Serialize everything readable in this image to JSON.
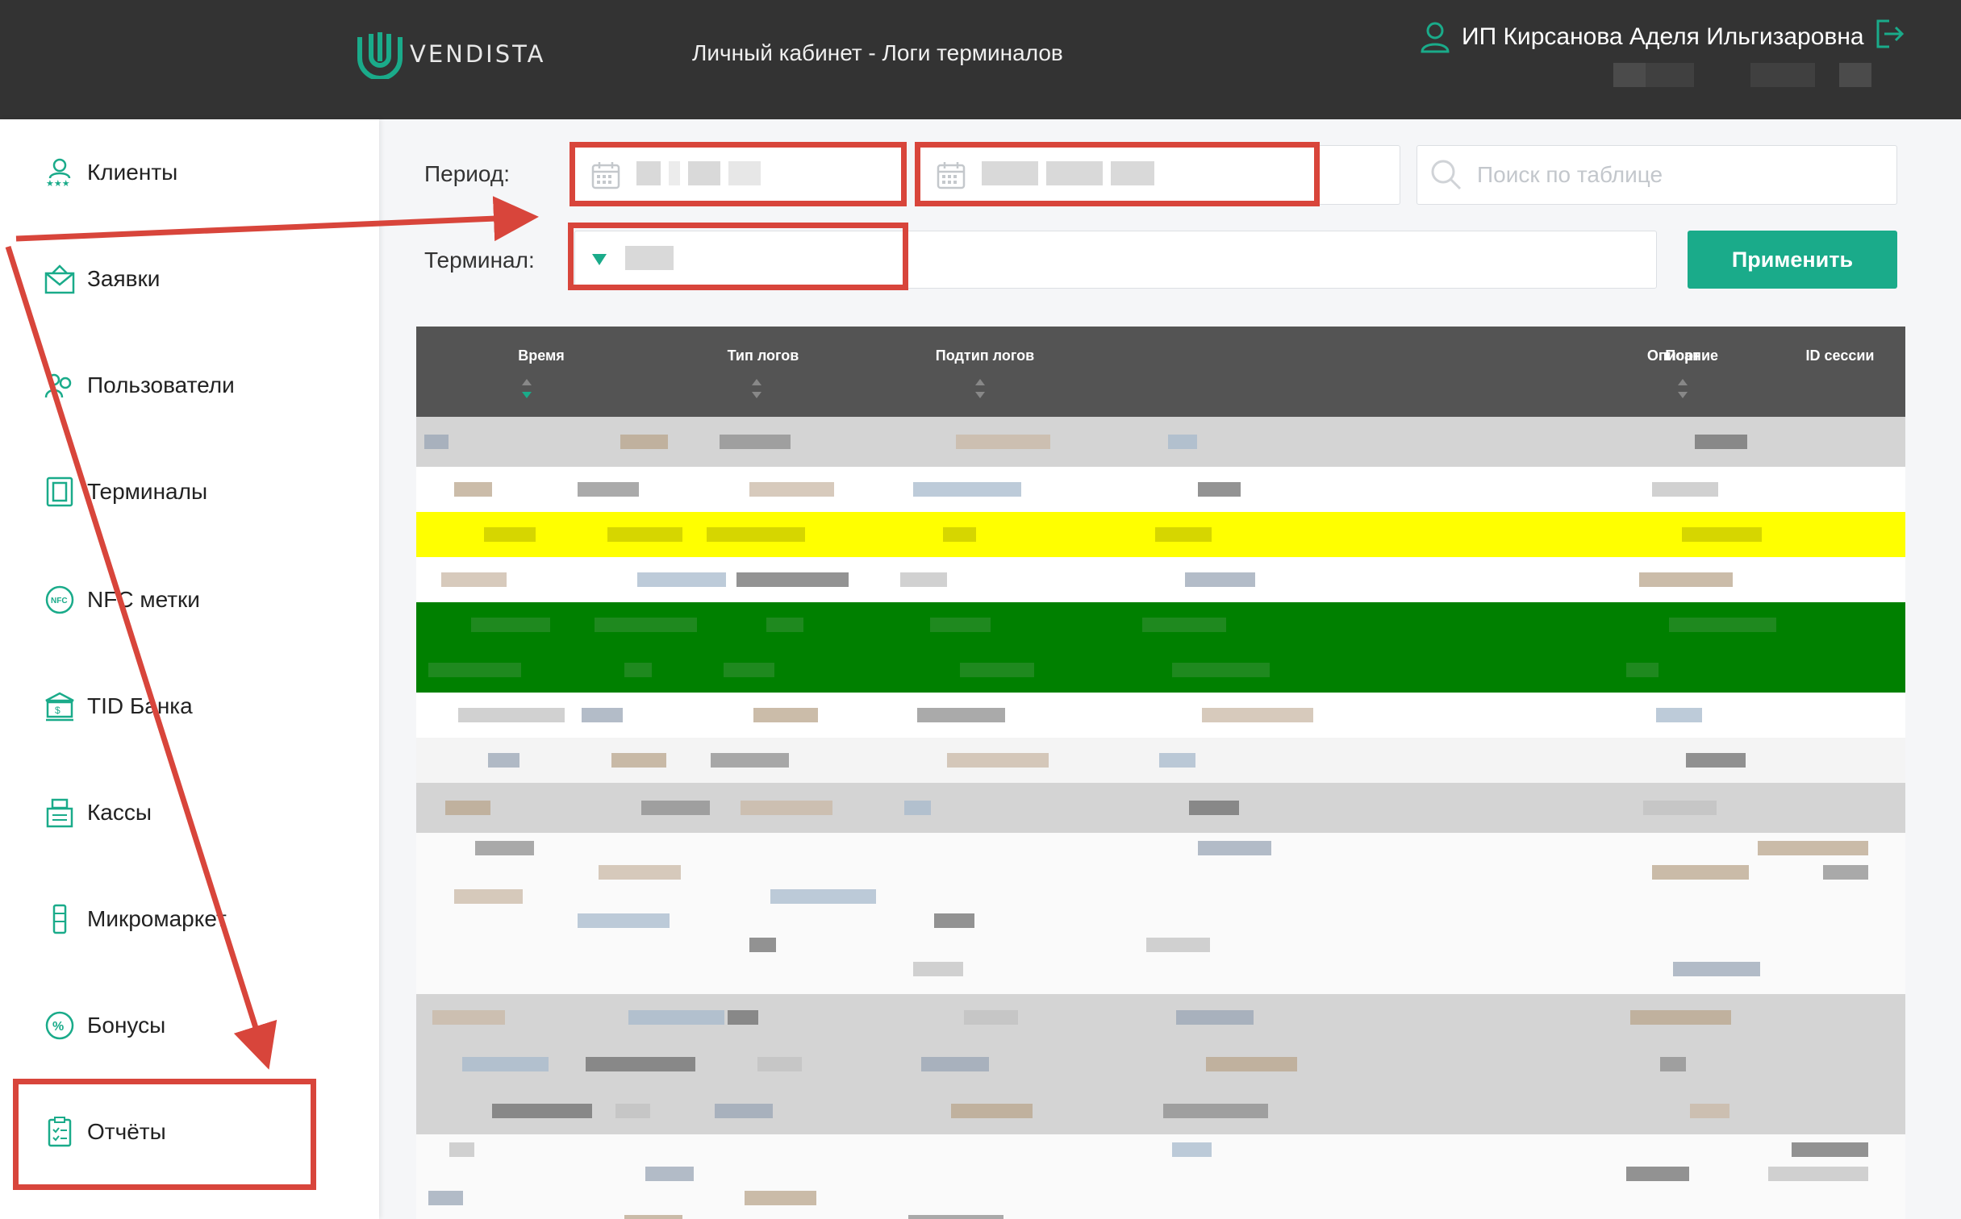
{
  "header": {
    "brand": "VENDISTA",
    "page_title": "Личный кабинет - Логи терминалов",
    "user_name": "ИП Кирсанова Аделя Ильгизаровна"
  },
  "sidebar": {
    "items": [
      {
        "label": "Клиенты",
        "icon": "users-star-icon"
      },
      {
        "label": "Заявки",
        "icon": "envelope-icon"
      },
      {
        "label": "Пользователи",
        "icon": "user-group-icon"
      },
      {
        "label": "Терминалы",
        "icon": "terminal-icon"
      },
      {
        "label": "NFC метки",
        "icon": "nfc-icon"
      },
      {
        "label": "TID Банка",
        "icon": "bank-icon"
      },
      {
        "label": "Кассы",
        "icon": "cash-register-icon"
      },
      {
        "label": "Микромаркет",
        "icon": "micromarket-icon"
      },
      {
        "label": "Бонусы",
        "icon": "percent-icon"
      },
      {
        "label": "Отчёты",
        "icon": "report-icon"
      }
    ]
  },
  "filters": {
    "period_label": "Период:",
    "terminal_label": "Терминал:",
    "search_placeholder": "Поиск по таблице",
    "apply_label": "Применить"
  },
  "table": {
    "columns": [
      "Время",
      "Тип логов",
      "Подтип логов",
      "Описание",
      "Порт",
      "ID сессии"
    ]
  },
  "colors": {
    "header_bg": "#333333",
    "accent": "#1aab8a",
    "annotation": "#d8453b",
    "row_highlight_yellow": "#ffff00",
    "row_highlight_green": "#008000"
  }
}
